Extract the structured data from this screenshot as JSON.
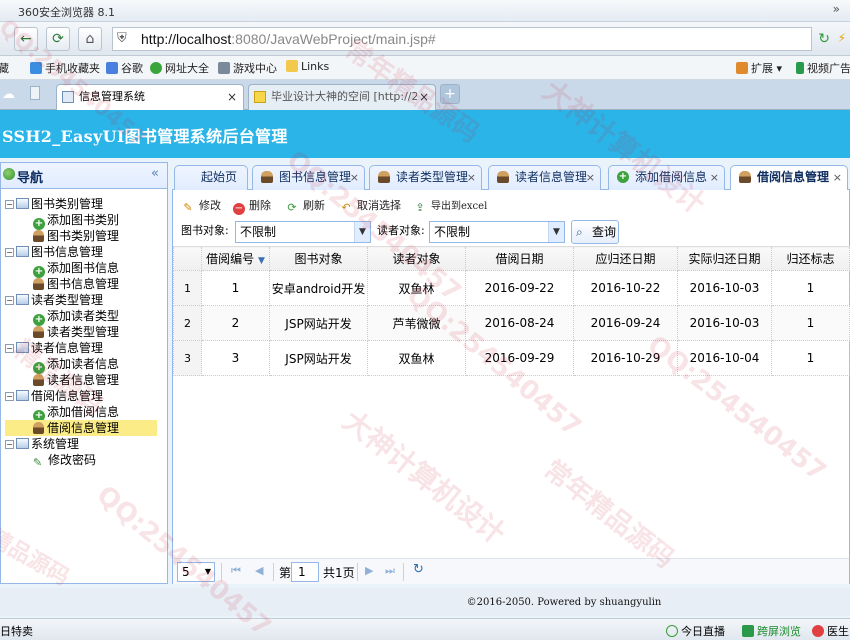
{
  "browser": {
    "title": "360安全浏览器 8.1",
    "url_host": "http://localhost",
    "url_path": ":8080/JavaWebProject/main.jsp#",
    "favorites": [
      "手机收藏夹",
      "谷歌",
      "网址大全",
      "游戏中心",
      "Links"
    ],
    "favorites_right": [
      "扩展",
      "视频广告"
    ],
    "fav_prefix": "藏",
    "tabs": [
      {
        "label": "信息管理系统"
      },
      {
        "label": "毕业设计大神的空间 [http://2"
      }
    ],
    "status": {
      "left": "日特卖",
      "live": "今日直播",
      "split": "跨屏浏览",
      "doctor": "医生"
    }
  },
  "app": {
    "title": "SSH2_EasyUI图书管理系统后台管理"
  },
  "nav": {
    "header": "导航",
    "groups": [
      {
        "label": "图书类别管理",
        "items": [
          {
            "label": "添加图书类别",
            "icon": "add"
          },
          {
            "label": "图书类别管理",
            "icon": "user"
          }
        ]
      },
      {
        "label": "图书信息管理",
        "items": [
          {
            "label": "添加图书信息",
            "icon": "add"
          },
          {
            "label": "图书信息管理",
            "icon": "user"
          }
        ]
      },
      {
        "label": "读者类型管理",
        "items": [
          {
            "label": "添加读者类型",
            "icon": "add"
          },
          {
            "label": "读者类型管理",
            "icon": "user"
          }
        ]
      },
      {
        "label": "读者信息管理",
        "items": [
          {
            "label": "添加读者信息",
            "icon": "add"
          },
          {
            "label": "读者信息管理",
            "icon": "user"
          }
        ]
      },
      {
        "label": "借阅信息管理",
        "items": [
          {
            "label": "添加借阅信息",
            "icon": "add"
          },
          {
            "label": "借阅信息管理",
            "icon": "user",
            "selected": true
          }
        ]
      },
      {
        "label": "系统管理",
        "items": [
          {
            "label": "修改密码",
            "icon": "pencil"
          }
        ]
      }
    ]
  },
  "content_tabs": [
    {
      "label": "起始页",
      "closable": false
    },
    {
      "label": "图书信息管理",
      "closable": true,
      "icon": "user"
    },
    {
      "label": "读者类型管理",
      "closable": true,
      "icon": "user"
    },
    {
      "label": "读者信息管理",
      "closable": true,
      "icon": "user"
    },
    {
      "label": "添加借阅信息",
      "closable": true,
      "icon": "add"
    },
    {
      "label": "借阅信息管理",
      "closable": true,
      "icon": "user",
      "active": true
    }
  ],
  "toolbar": {
    "edit": "修改",
    "delete": "删除",
    "refresh": "刷新",
    "cancel_select": "取消选择",
    "export": "导出到excel"
  },
  "filters": {
    "book_label": "图书对象:",
    "book_value": "不限制",
    "reader_label": "读者对象:",
    "reader_value": "不限制",
    "query": "查询"
  },
  "table": {
    "columns": [
      "借阅编号",
      "图书对象",
      "读者对象",
      "借阅日期",
      "应归还日期",
      "实际归还日期",
      "归还标志"
    ],
    "rows": [
      {
        "rownum": "1",
        "id": "1",
        "book": "安卓android开发",
        "reader": "双鱼林",
        "borrow": "2016-09-22",
        "due": "2016-10-22",
        "returned": "2016-10-03",
        "flag": "1"
      },
      {
        "rownum": "2",
        "id": "2",
        "book": "JSP网站开发",
        "reader": "芦苇微微",
        "borrow": "2016-08-24",
        "due": "2016-09-24",
        "returned": "2016-10-03",
        "flag": "1"
      },
      {
        "rownum": "3",
        "id": "3",
        "book": "JSP网站开发",
        "reader": "双鱼林",
        "borrow": "2016-09-29",
        "due": "2016-10-29",
        "returned": "2016-10-04",
        "flag": "1"
      }
    ]
  },
  "pager": {
    "page_size": "5",
    "page_prefix": "第",
    "page": "1",
    "page_suffix": "共1页"
  },
  "footer": "©2016-2050. Powered by shuangyulin",
  "watermarks": [
    "QQ:254540457",
    "大神计算机设计",
    "精品源码",
    "常年精品源码"
  ]
}
